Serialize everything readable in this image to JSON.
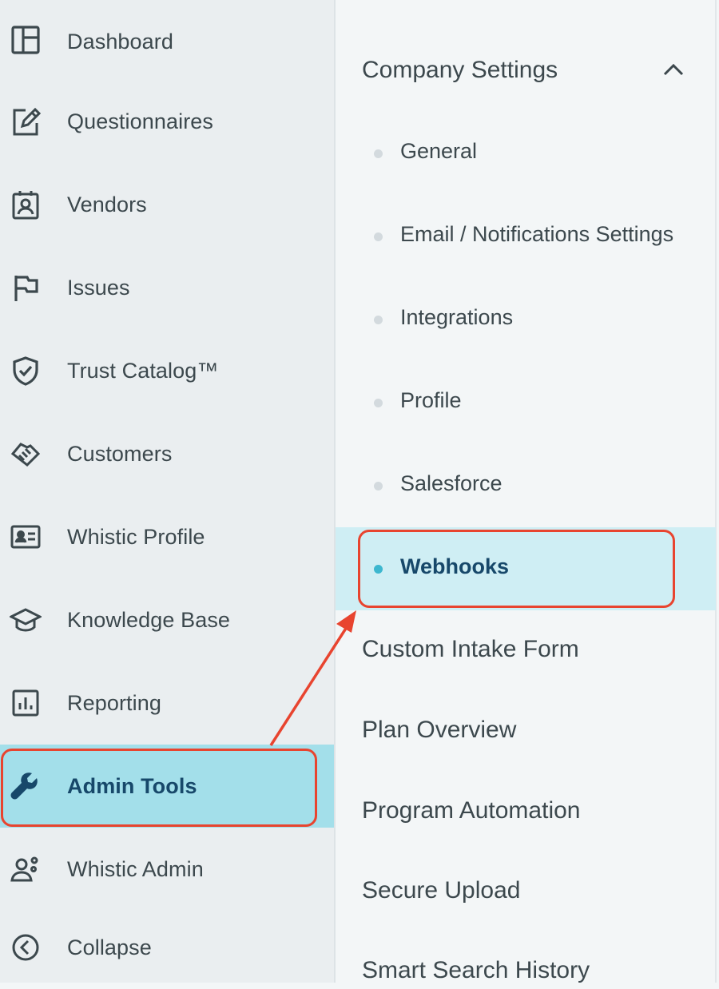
{
  "sidebar": {
    "items": [
      {
        "label": "Dashboard",
        "icon": "dashboard-icon"
      },
      {
        "label": "Questionnaires",
        "icon": "edit-document-icon"
      },
      {
        "label": "Vendors",
        "icon": "vendor-badge-icon"
      },
      {
        "label": "Issues",
        "icon": "flag-icon"
      },
      {
        "label": "Trust Catalog™",
        "icon": "shield-check-icon"
      },
      {
        "label": "Customers",
        "icon": "handshake-icon"
      },
      {
        "label": "Whistic Profile",
        "icon": "id-card-icon"
      },
      {
        "label": "Knowledge Base",
        "icon": "graduation-cap-icon"
      },
      {
        "label": "Reporting",
        "icon": "bar-chart-icon"
      },
      {
        "label": "Admin Tools",
        "icon": "wrench-icon",
        "active": true
      },
      {
        "label": "Whistic Admin",
        "icon": "admin-user-gear-icon"
      },
      {
        "label": "Collapse",
        "icon": "chevron-left-circle-icon"
      }
    ]
  },
  "submenu": {
    "section_title": "Company Settings",
    "section_icon": "chevron-up-icon",
    "items": [
      {
        "label": "General"
      },
      {
        "label": "Email / Notifications Settings"
      },
      {
        "label": "Integrations"
      },
      {
        "label": "Profile"
      },
      {
        "label": "Salesforce"
      },
      {
        "label": "Webhooks",
        "active": true
      }
    ],
    "top_items": [
      {
        "label": "Custom Intake Form"
      },
      {
        "label": "Plan Overview"
      },
      {
        "label": "Program Automation"
      },
      {
        "label": "Secure Upload"
      },
      {
        "label": "Smart Search History"
      }
    ]
  },
  "colors": {
    "active_bg": "#a3dfea",
    "active_sub_bg": "#cfeef4",
    "active_text": "#17486a",
    "highlight": "#e8442f",
    "active_dot": "#3db7cf"
  }
}
